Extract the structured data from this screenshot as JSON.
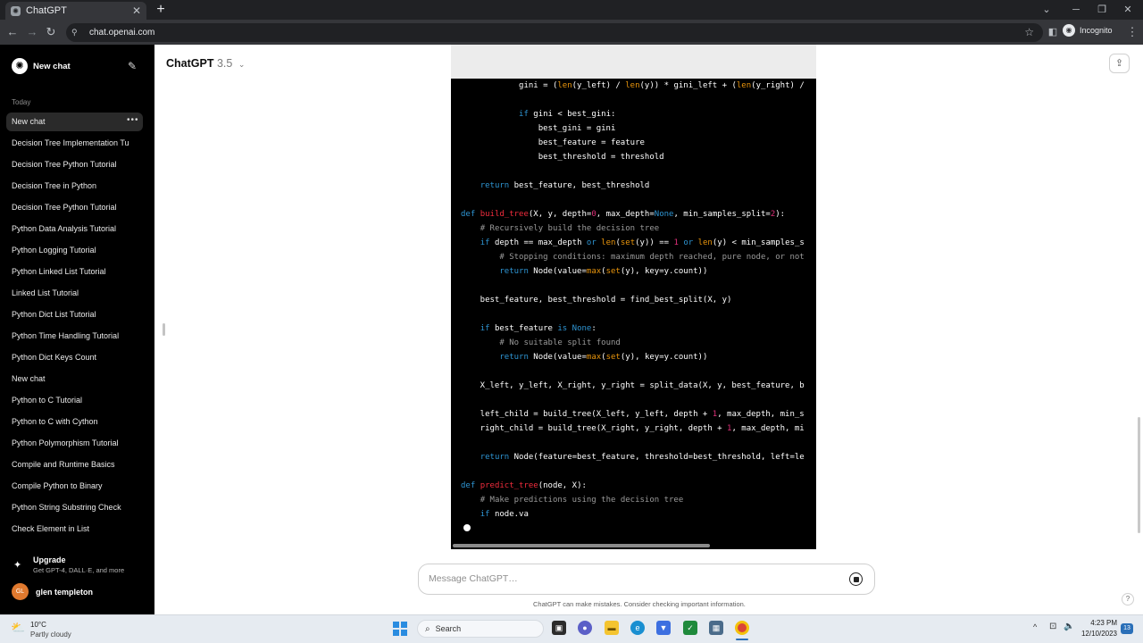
{
  "browser": {
    "tab_title": "ChatGPT",
    "tab_close": "✕",
    "new_tab": "+",
    "url": "chat.openai.com",
    "profile": "Incognito"
  },
  "sidebar": {
    "new_chat_label": "New chat",
    "section_today": "Today",
    "history": [
      "New chat",
      "Decision Tree Implementation Tu",
      "Decision Tree Python Tutorial",
      "Decision Tree in Python",
      "Decision Tree Python Tutorial",
      "Python Data Analysis Tutorial",
      "Python Logging Tutorial",
      "Python Linked List Tutorial",
      "Linked List Tutorial",
      "Python Dict List Tutorial",
      "Python Time Handling Tutorial",
      "Python Dict Keys Count",
      "New chat",
      "Python to C Tutorial",
      "Python to C with Cython",
      "Python Polymorphism Tutorial",
      "Compile and Runtime Basics",
      "Compile Python to Binary",
      "Python String Substring Check",
      "Check Element in List"
    ],
    "upgrade_title": "Upgrade",
    "upgrade_subtitle": "Get GPT-4, DALL·E, and more",
    "user_initials": "GL",
    "user_name": "glen templeton"
  },
  "header": {
    "model_name": "ChatGPT",
    "model_version": "3.5"
  },
  "code_lines": [
    [
      [
        "            gini = (",
        ""
      ],
      [
        "len",
        "bi"
      ],
      [
        "(y_left) / ",
        ""
      ],
      [
        "len",
        "bi"
      ],
      [
        "(y)) * gini_left + (",
        ""
      ],
      [
        "len",
        "bi"
      ],
      [
        "(y_right) /",
        ""
      ]
    ],
    [],
    [
      [
        "            ",
        ""
      ],
      [
        "if",
        "k"
      ],
      [
        " gini < best_gini:",
        ""
      ]
    ],
    [
      [
        "                best_gini = gini",
        ""
      ]
    ],
    [
      [
        "                best_feature = feature",
        ""
      ]
    ],
    [
      [
        "                best_threshold = threshold",
        ""
      ]
    ],
    [],
    [
      [
        "    ",
        ""
      ],
      [
        "return",
        "k"
      ],
      [
        " best_feature, best_threshold",
        ""
      ]
    ],
    [],
    [
      [
        "def",
        "k"
      ],
      [
        " ",
        ""
      ],
      [
        "build_tree",
        "f"
      ],
      [
        "(X, y, depth=",
        ""
      ],
      [
        "0",
        "n"
      ],
      [
        ", max_depth=",
        ""
      ],
      [
        "None",
        "k"
      ],
      [
        ", min_samples_split=",
        ""
      ],
      [
        "2",
        "n"
      ],
      [
        "):",
        ""
      ]
    ],
    [
      [
        "    ",
        ""
      ],
      [
        "# Recursively build the decision tree",
        "c"
      ]
    ],
    [
      [
        "    ",
        ""
      ],
      [
        "if",
        "k"
      ],
      [
        " depth == max_depth ",
        ""
      ],
      [
        "or",
        "k"
      ],
      [
        " ",
        ""
      ],
      [
        "len",
        "bi"
      ],
      [
        "(",
        ""
      ],
      [
        "set",
        "bi"
      ],
      [
        "(y)) == ",
        ""
      ],
      [
        "1",
        "n"
      ],
      [
        " ",
        ""
      ],
      [
        "or",
        "k"
      ],
      [
        " ",
        ""
      ],
      [
        "len",
        "bi"
      ],
      [
        "(y) < min_samples_s",
        ""
      ]
    ],
    [
      [
        "        ",
        ""
      ],
      [
        "# Stopping conditions: maximum depth reached, pure node, or not",
        "c"
      ]
    ],
    [
      [
        "        ",
        ""
      ],
      [
        "return",
        "k"
      ],
      [
        " Node(value=",
        ""
      ],
      [
        "max",
        "bi"
      ],
      [
        "(",
        ""
      ],
      [
        "set",
        "bi"
      ],
      [
        "(y), key=y.count))",
        ""
      ]
    ],
    [],
    [
      [
        "    best_feature, best_threshold = find_best_split(X, y)",
        ""
      ]
    ],
    [],
    [
      [
        "    ",
        ""
      ],
      [
        "if",
        "k"
      ],
      [
        " best_feature ",
        ""
      ],
      [
        "is",
        "k"
      ],
      [
        " ",
        ""
      ],
      [
        "None",
        "k"
      ],
      [
        ":",
        ""
      ]
    ],
    [
      [
        "        ",
        ""
      ],
      [
        "# No suitable split found",
        "c"
      ]
    ],
    [
      [
        "        ",
        ""
      ],
      [
        "return",
        "k"
      ],
      [
        " Node(value=",
        ""
      ],
      [
        "max",
        "bi"
      ],
      [
        "(",
        ""
      ],
      [
        "set",
        "bi"
      ],
      [
        "(y), key=y.count))",
        ""
      ]
    ],
    [],
    [
      [
        "    X_left, y_left, X_right, y_right = split_data(X, y, best_feature, b",
        ""
      ]
    ],
    [],
    [
      [
        "    left_child = build_tree(X_left, y_left, depth + ",
        ""
      ],
      [
        "1",
        "n"
      ],
      [
        ", max_depth, min_s",
        ""
      ]
    ],
    [
      [
        "    right_child = build_tree(X_right, y_right, depth + ",
        ""
      ],
      [
        "1",
        "n"
      ],
      [
        ", max_depth, mi",
        ""
      ]
    ],
    [],
    [
      [
        "    ",
        ""
      ],
      [
        "return",
        "k"
      ],
      [
        " Node(feature=best_feature, threshold=best_threshold, left=le",
        ""
      ]
    ],
    [],
    [
      [
        "def",
        "k"
      ],
      [
        " ",
        ""
      ],
      [
        "predict_tree",
        "f"
      ],
      [
        "(node, X):",
        ""
      ]
    ],
    [
      [
        "    ",
        ""
      ],
      [
        "# Make predictions using the decision tree",
        "c"
      ]
    ],
    [
      [
        "    ",
        ""
      ],
      [
        "if",
        "k"
      ],
      [
        " node.va",
        ""
      ]
    ]
  ],
  "composer": {
    "placeholder": "Message ChatGPT…"
  },
  "disclaimer": "ChatGPT can make mistakes. Consider checking important information.",
  "help": "?",
  "taskbar": {
    "temperature": "10°C",
    "condition": "Partly cloudy",
    "search_label": "Search",
    "time": "4:23 PM",
    "date": "12/10/2023",
    "notification_count": "13"
  }
}
